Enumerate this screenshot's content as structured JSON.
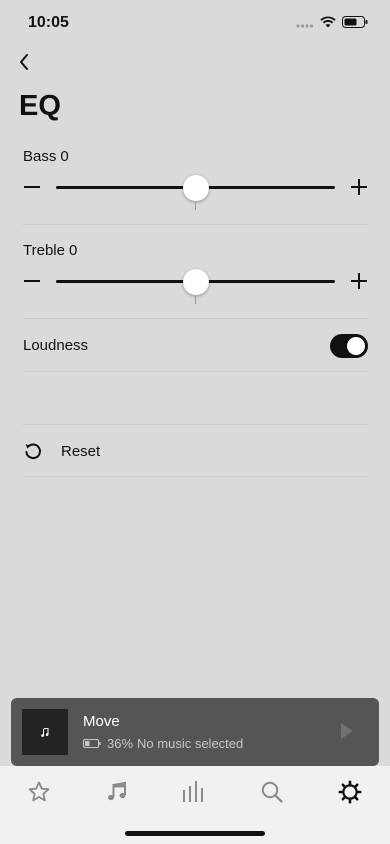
{
  "status_bar": {
    "time": "10:05"
  },
  "header": {
    "title": "EQ"
  },
  "eq": {
    "bass": {
      "label": "Bass",
      "value": "0",
      "level": 0.5
    },
    "treble": {
      "label": "Treble",
      "value": "0",
      "level": 0.5
    },
    "minus_symbol": "−",
    "plus_symbol": "+"
  },
  "loudness": {
    "label": "Loudness",
    "enabled": true
  },
  "reset": {
    "label": "Reset"
  },
  "now_playing": {
    "title": "Move",
    "battery": "36%",
    "status": "No music selected"
  },
  "tabs": [
    {
      "icon": "star-icon"
    },
    {
      "icon": "music-note-icon"
    },
    {
      "icon": "rooms-icon"
    },
    {
      "icon": "search-icon"
    },
    {
      "icon": "gear-icon"
    }
  ],
  "colors": {
    "background": "#dadada",
    "accent": "#111111",
    "now_playing_bg": "#555555",
    "tab_bar_bg": "#f1f1f1",
    "inactive_tab": "#8a8a8a"
  }
}
